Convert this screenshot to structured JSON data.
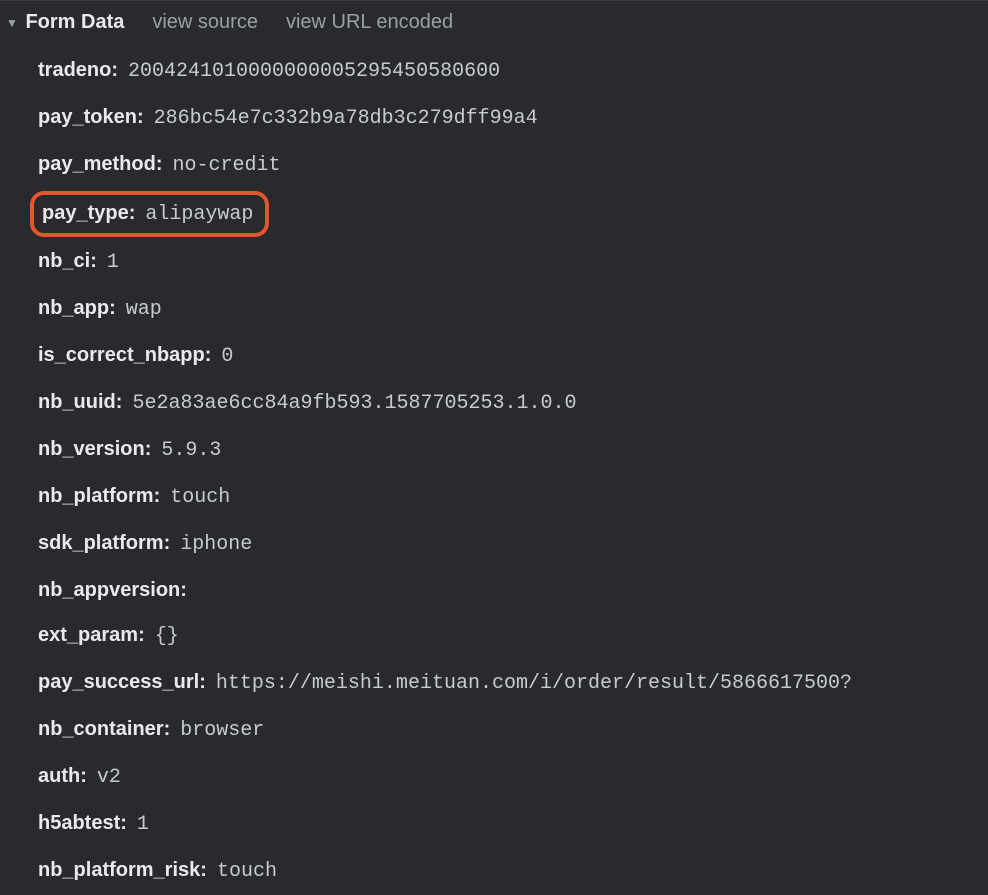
{
  "header": {
    "title": "Form Data",
    "view_source_label": "view source",
    "view_url_encoded_label": "view URL encoded"
  },
  "form_data": [
    {
      "key": "tradeno",
      "value": "2004241010000000005295450580600",
      "highlighted": false
    },
    {
      "key": "pay_token",
      "value": "286bc54e7c332b9a78db3c279dff99a4",
      "highlighted": false
    },
    {
      "key": "pay_method",
      "value": "no-credit",
      "highlighted": false
    },
    {
      "key": "pay_type",
      "value": "alipaywap",
      "highlighted": true
    },
    {
      "key": "nb_ci",
      "value": "1",
      "highlighted": false
    },
    {
      "key": "nb_app",
      "value": "wap",
      "highlighted": false
    },
    {
      "key": "is_correct_nbapp",
      "value": "0",
      "highlighted": false
    },
    {
      "key": "nb_uuid",
      "value": "5e2a83ae6cc84a9fb593.1587705253.1.0.0",
      "highlighted": false
    },
    {
      "key": "nb_version",
      "value": "5.9.3",
      "highlighted": false
    },
    {
      "key": "nb_platform",
      "value": "touch",
      "highlighted": false
    },
    {
      "key": "sdk_platform",
      "value": "iphone",
      "highlighted": false
    },
    {
      "key": "nb_appversion",
      "value": "",
      "highlighted": false
    },
    {
      "key": "ext_param",
      "value": "{}",
      "highlighted": false
    },
    {
      "key": "pay_success_url",
      "value": "https://meishi.meituan.com/i/order/result/5866617500?",
      "highlighted": false
    },
    {
      "key": "nb_container",
      "value": "browser",
      "highlighted": false
    },
    {
      "key": "auth",
      "value": "v2",
      "highlighted": false
    },
    {
      "key": "h5abtest",
      "value": "1",
      "highlighted": false
    },
    {
      "key": "nb_platform_risk",
      "value": "touch",
      "highlighted": false
    }
  ]
}
